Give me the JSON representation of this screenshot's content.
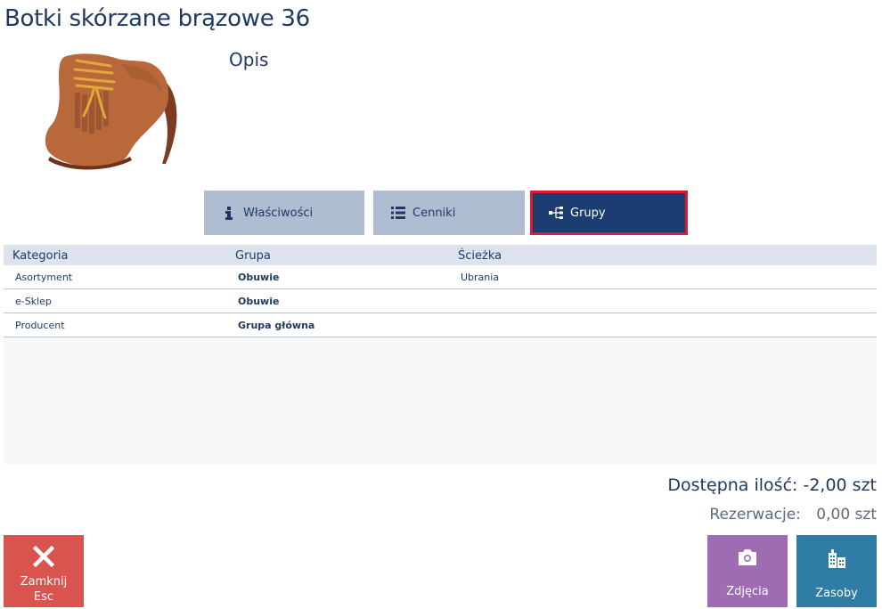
{
  "product": {
    "title": "Botki skórzane brązowe 36",
    "description_label": "Opis"
  },
  "tabs": [
    {
      "label": "Właściwości",
      "icon": "info-icon",
      "active": false
    },
    {
      "label": "Cenniki",
      "icon": "list-icon",
      "active": false
    },
    {
      "label": "Grupy",
      "icon": "hierarchy-icon",
      "active": true
    }
  ],
  "table": {
    "headers": [
      "Kategoria",
      "Grupa",
      "Ścieżka"
    ],
    "rows": [
      [
        "Asortyment",
        "Obuwie",
        "Ubrania"
      ],
      [
        "e-Sklep",
        "Obuwie",
        ""
      ],
      [
        "Producent",
        "Grupa główna",
        ""
      ]
    ]
  },
  "stock": {
    "available_label": "Dostępna ilość:",
    "available_value": "-2,00 szt",
    "reservations_label": "Rezerwacje:",
    "reservations_value": "0,00 szt"
  },
  "buttons": {
    "close_label": "Zamknij",
    "close_shortcut": "Esc",
    "photos_label": "Zdjęcia",
    "resources_label": "Zasoby"
  },
  "colors": {
    "active_tab": "#1b3d72",
    "inactive_tab": "#aebdd1",
    "highlight_border": "#e1192b",
    "close_button": "#d9534f",
    "photos_button": "#9f6bb3",
    "resources_button": "#2f7ca6"
  }
}
